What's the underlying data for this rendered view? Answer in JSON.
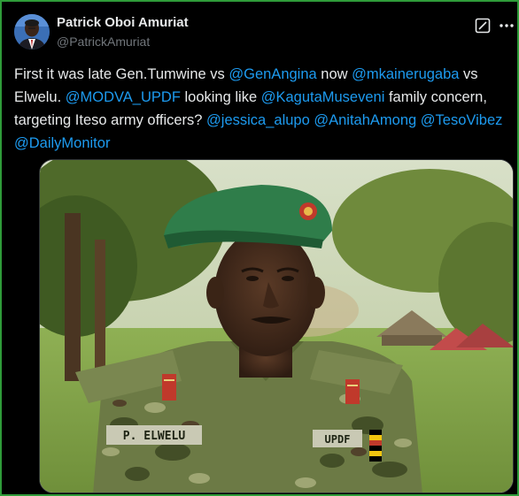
{
  "author": {
    "display_name": "Patrick Oboi Amuriat",
    "handle": "@PatrickAmuriat"
  },
  "tweet": {
    "segments": [
      {
        "text": "First it was late Gen.Tumwine vs ",
        "type": "text"
      },
      {
        "text": "@GenAngina",
        "type": "mention"
      },
      {
        "text": " now ",
        "type": "text"
      },
      {
        "text": "@mkainerugaba",
        "type": "mention"
      },
      {
        "text": " vs Elwelu. ",
        "type": "text"
      },
      {
        "text": "@MODVA_UPDF",
        "type": "mention"
      },
      {
        "text": " looking like ",
        "type": "text"
      },
      {
        "text": "@KagutaMuseveni",
        "type": "mention"
      },
      {
        "text": " family concern, targeting Iteso army officers? ",
        "type": "text"
      },
      {
        "text": "@jessica_alupo",
        "type": "mention"
      },
      {
        "text": " ",
        "type": "text"
      },
      {
        "text": "@AnitahAmong",
        "type": "mention"
      },
      {
        "text": " ",
        "type": "text"
      },
      {
        "text": "@TesoVibez",
        "type": "mention"
      },
      {
        "text": " ",
        "type": "text"
      },
      {
        "text": "@DailyMonitor",
        "type": "mention"
      }
    ]
  },
  "photo": {
    "name_tape": "P. ELWELU",
    "branch_tape": "UPDF"
  },
  "icons": {
    "grok": "grok-icon",
    "more": "more-options-icon"
  },
  "colors": {
    "background": "#000000",
    "text": "#e7e9ea",
    "secondary": "#71767b",
    "link": "#1d9bf0",
    "frame": "#2f9c3a"
  }
}
